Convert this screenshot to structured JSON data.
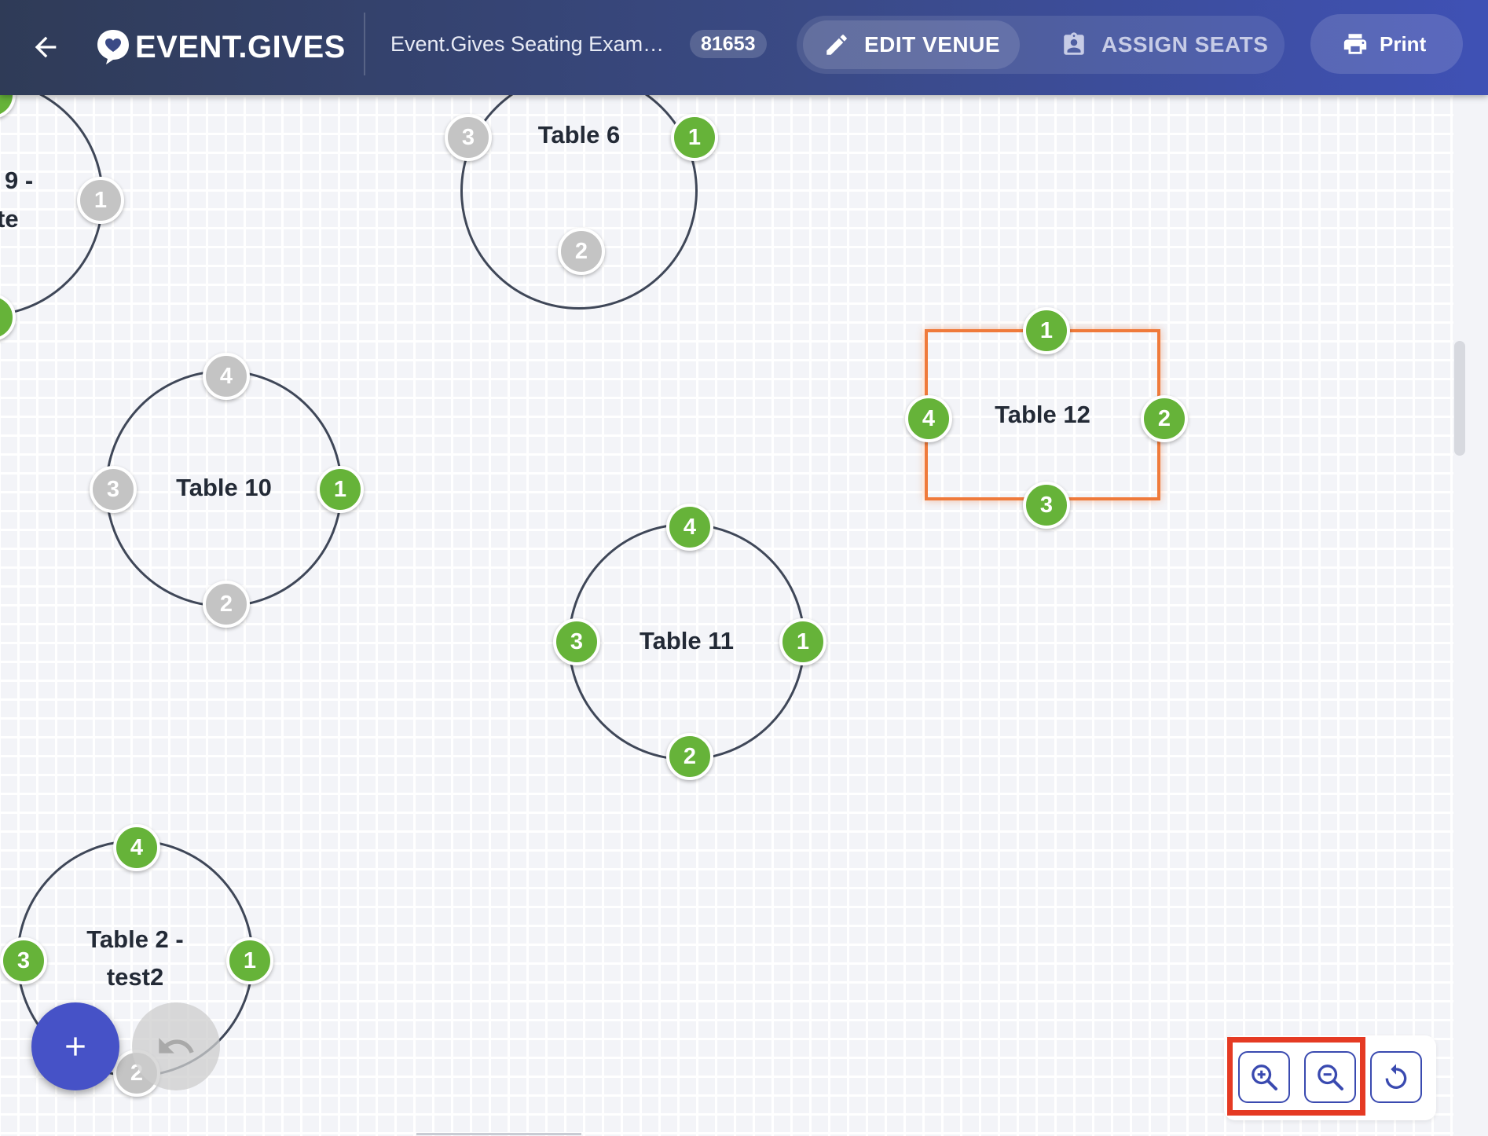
{
  "header": {
    "back_icon": "arrow-left-icon",
    "logo_icon": "heart-chat-icon",
    "logo_text": "EVENT.GIVES",
    "event_title": "Event.Gives Seating Exam…",
    "event_id": "81653",
    "modes": {
      "edit": {
        "label": "EDIT VENUE",
        "icon": "pencil-icon"
      },
      "assign": {
        "label": "ASSIGN SEATS",
        "icon": "badge-icon"
      }
    },
    "print": {
      "label": "Print",
      "icon": "printer-icon"
    }
  },
  "colors": {
    "header_start": "#2f3b57",
    "header_end": "#3f51b5",
    "seat_occupied": "#66b339",
    "seat_empty": "#c4c4c4",
    "selected_table": "#ef7a3b",
    "fab": "#4652c7",
    "highlight": "#e53a23"
  },
  "tables": [
    {
      "id": "t9",
      "label_line1": "9 -",
      "label_line2": "te",
      "seats": {
        "s1": "1"
      }
    },
    {
      "id": "t6",
      "label": "Table 6",
      "seats": {
        "s1": "1",
        "s2": "2",
        "s3": "3"
      }
    },
    {
      "id": "t10",
      "label": "Table 10",
      "seats": {
        "s1": "1",
        "s2": "2",
        "s3": "3",
        "s4": "4"
      }
    },
    {
      "id": "t12",
      "label": "Table 12",
      "selected": true,
      "seats": {
        "s1": "1",
        "s2": "2",
        "s3": "3",
        "s4": "4"
      }
    },
    {
      "id": "t11",
      "label": "Table 11",
      "seats": {
        "s1": "1",
        "s2": "2",
        "s3": "3",
        "s4": "4"
      }
    },
    {
      "id": "t2",
      "label_line1": "Table 2 -",
      "label_line2": "test2",
      "seats": {
        "s1": "1",
        "s2": "2",
        "s3": "3",
        "s4": "4"
      }
    }
  ],
  "controls": {
    "add": {
      "icon": "plus-icon"
    },
    "undo": {
      "icon": "undo-icon"
    },
    "zoom_in": {
      "icon": "zoom-in-icon"
    },
    "zoom_out": {
      "icon": "zoom-out-icon"
    },
    "reset": {
      "icon": "reset-rotate-icon"
    }
  }
}
